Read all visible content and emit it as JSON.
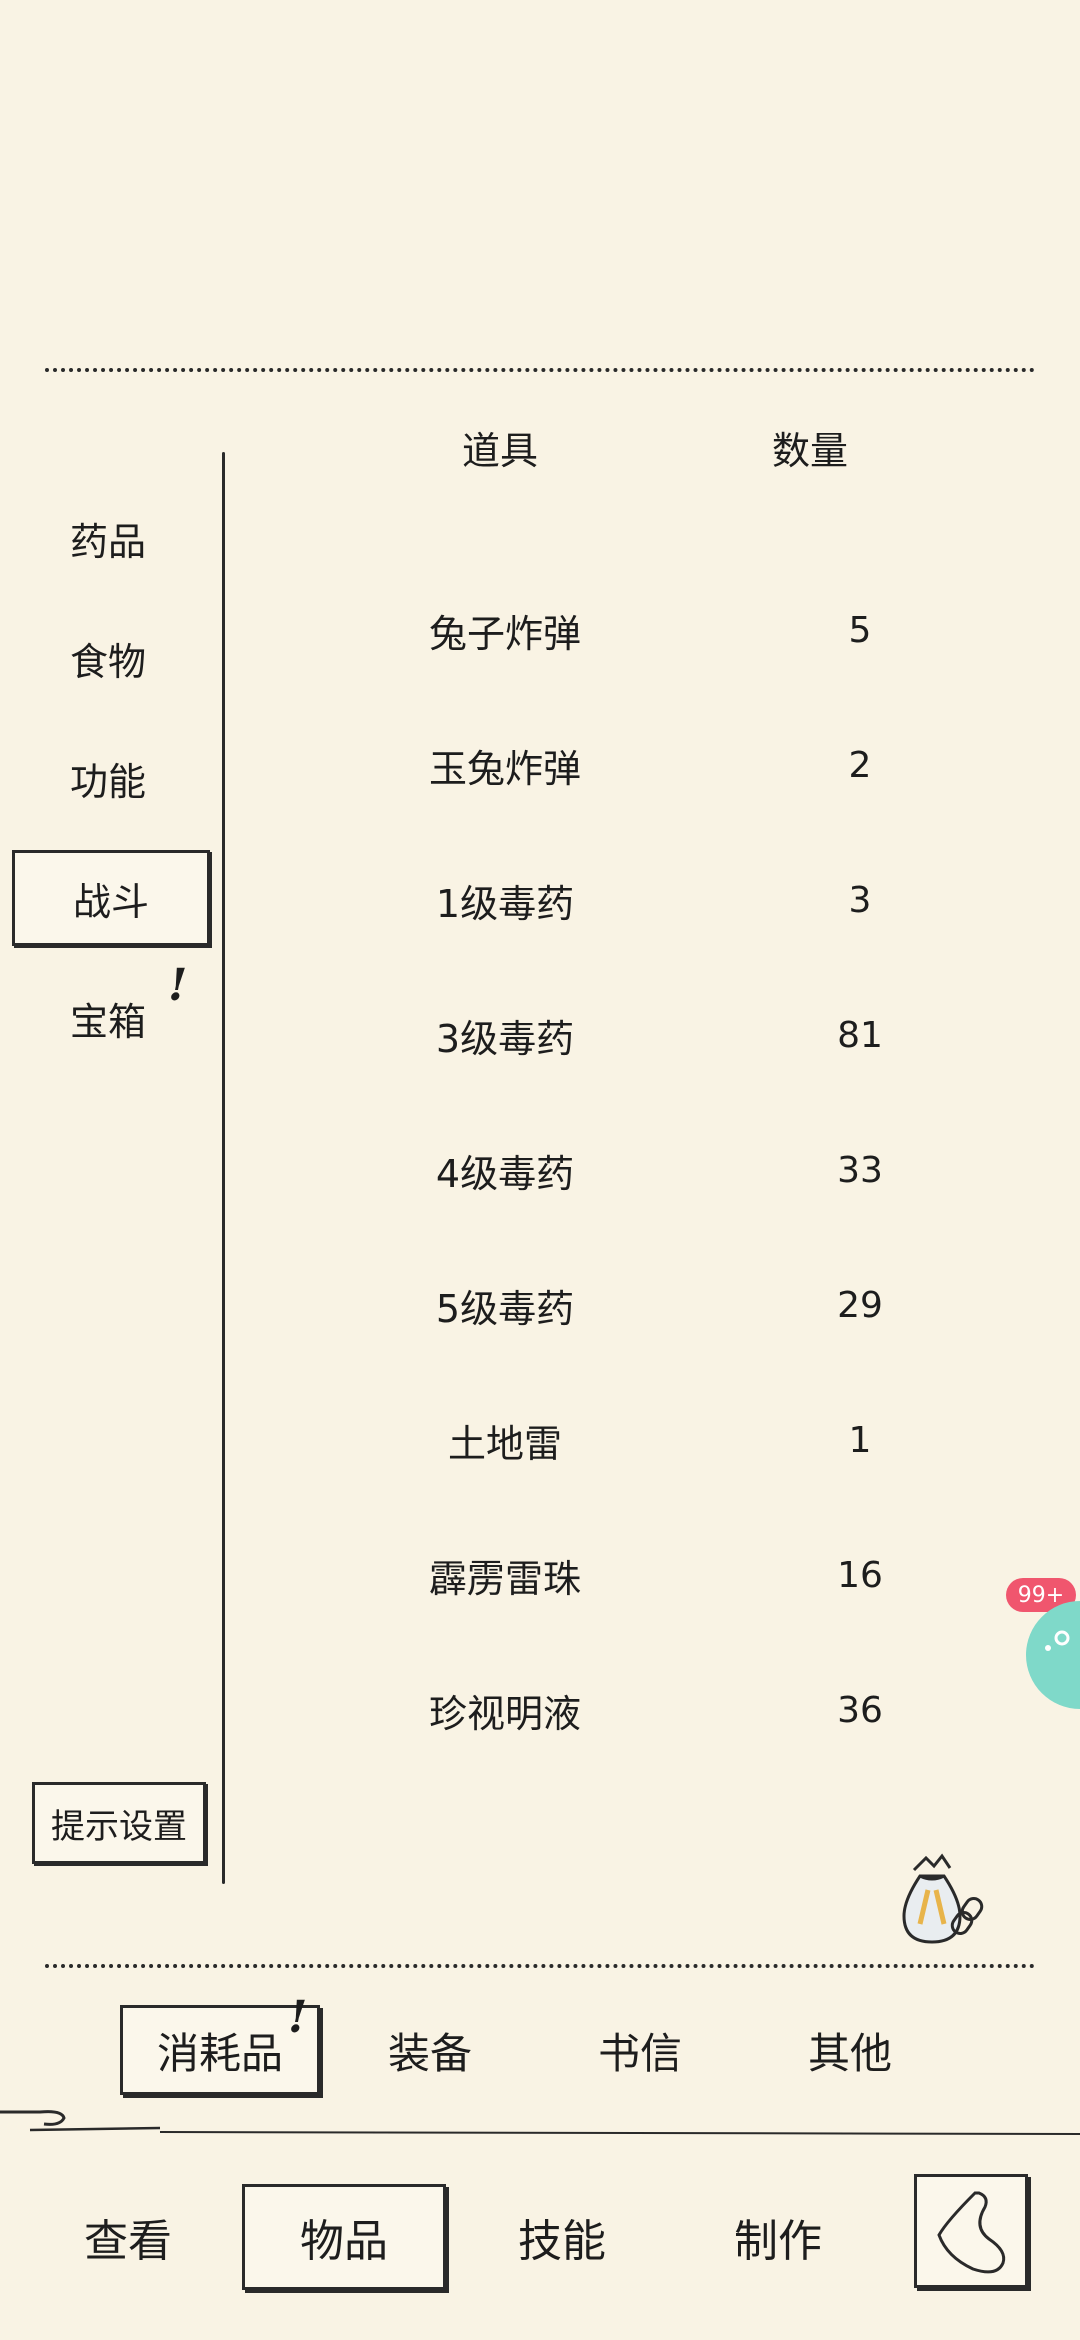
{
  "table": {
    "header_item": "道具",
    "header_qty": "数量",
    "rows": [
      {
        "name": "兔子炸弹",
        "qty": "5"
      },
      {
        "name": "玉兔炸弹",
        "qty": "2"
      },
      {
        "name": "1级毒药",
        "qty": "3"
      },
      {
        "name": "3级毒药",
        "qty": "81"
      },
      {
        "name": "4级毒药",
        "qty": "33"
      },
      {
        "name": "5级毒药",
        "qty": "29"
      },
      {
        "name": "土地雷",
        "qty": "1"
      },
      {
        "name": "霹雳雷珠",
        "qty": "16"
      },
      {
        "name": "珍视明液",
        "qty": "36"
      }
    ]
  },
  "categories": {
    "items": [
      {
        "label": "药品"
      },
      {
        "label": "食物"
      },
      {
        "label": "功能"
      },
      {
        "label": "战斗"
      },
      {
        "label": "宝箱"
      }
    ],
    "active_index": 3
  },
  "tip_settings_label": "提示设置",
  "subtabs": {
    "items": [
      {
        "label": "消耗品"
      },
      {
        "label": "装备"
      },
      {
        "label": "书信"
      },
      {
        "label": "其他"
      }
    ],
    "active_index": 0
  },
  "nav": {
    "items": [
      {
        "label": "查看"
      },
      {
        "label": "物品"
      },
      {
        "label": "技能"
      },
      {
        "label": "制作"
      }
    ],
    "active_index": 1
  },
  "floating_badge": "99+",
  "alert_mark": "!",
  "colors": {
    "background": "#f9f3e4",
    "ink": "#1d1d1d",
    "badge": "#f0566e",
    "bubble": "#7fd9c9"
  }
}
